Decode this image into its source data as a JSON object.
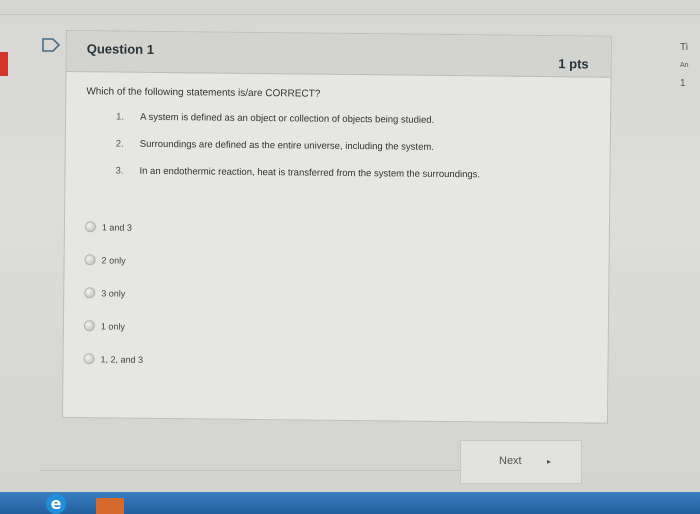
{
  "question": {
    "title": "Question 1",
    "points": "1 pts",
    "text": "Which of the following statements is/are CORRECT?",
    "statements": [
      {
        "num": "1.",
        "text": "A system is defined as an object or collection of objects being studied."
      },
      {
        "num": "2.",
        "text": "Surroundings are defined as the entire universe, including the system."
      },
      {
        "num": "3.",
        "text": "In an endothermic reaction, heat is transferred from the system   the surroundings."
      }
    ],
    "answers": [
      {
        "label": "1 and 3"
      },
      {
        "label": "2 only"
      },
      {
        "label": "3 only"
      },
      {
        "label": "1 only"
      },
      {
        "label": "1, 2, and 3"
      }
    ]
  },
  "side": {
    "line1": "Ti",
    "line2": "An",
    "line3": "1"
  },
  "navigation": {
    "next_label": "Next",
    "next_arrow": "▸"
  },
  "taskbar": {
    "browser_icon": "e"
  },
  "colors": {
    "accent_red": "#d4332a",
    "taskbar_blue": "#2b6cb0"
  },
  "icons": [
    "flag-icon",
    "ie-icon",
    "office-icon"
  ]
}
